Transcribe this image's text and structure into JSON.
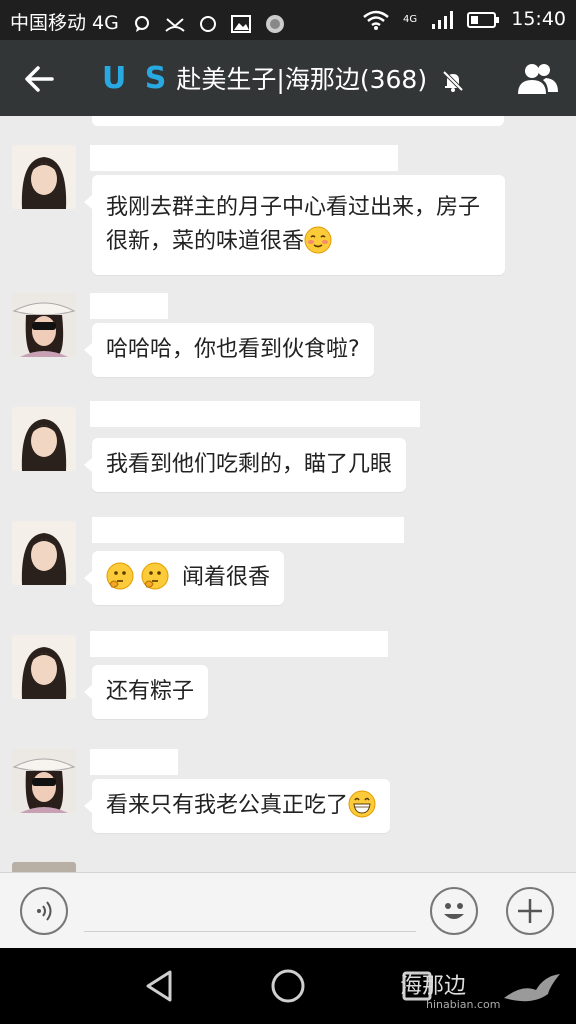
{
  "statusbar": {
    "carrier": "中国移动 4G",
    "time": "15:40",
    "network": "4G"
  },
  "header": {
    "us_logo": "U S",
    "title": "赴美生子|海那边(368)"
  },
  "messages": [
    {
      "text": "我刚去群主的月子中心看过出来，房子很新，菜的味道很香",
      "emoji": "blush-emoji"
    },
    {
      "text": "哈哈哈，你也看到伙食啦?"
    },
    {
      "text": "我看到他们吃剩的，瞄了几眼"
    },
    {
      "text": "闻着很香",
      "prefix_emoji": [
        "thinking-emoji",
        "thinking-emoji"
      ]
    },
    {
      "text": "还有粽子"
    },
    {
      "text": "看来只有我老公真正吃了",
      "emoji": "grin-emoji"
    }
  ],
  "watermark": {
    "brand": "海那边",
    "url": "hinabian.com"
  },
  "colors": {
    "accent": "#29a9e1",
    "header_bg": "#333637",
    "chat_bg": "#ebebeb"
  }
}
